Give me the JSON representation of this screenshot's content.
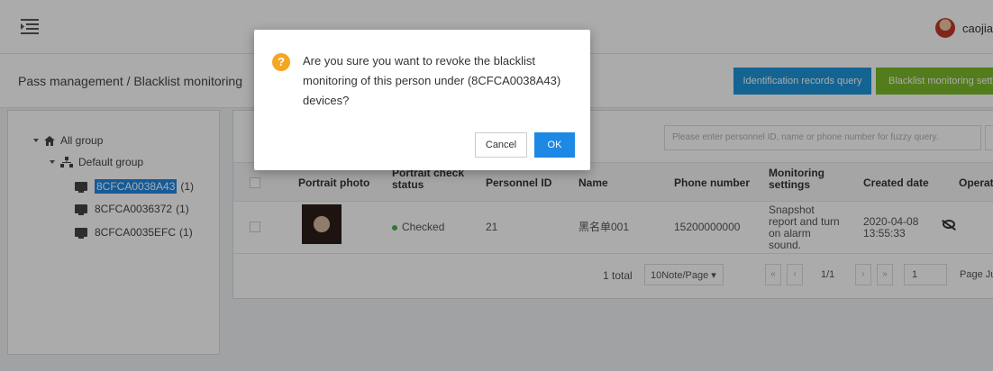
{
  "topbar": {
    "user_name": "caojia",
    "icons": [
      "menu-toggle-icon",
      "avatar"
    ]
  },
  "header": {
    "breadcrumb": "Pass management  /  Blacklist monitoring",
    "btn_identification": "Identification records query",
    "btn_blacklist": "Blacklist monitoring sett"
  },
  "tree": {
    "root_label": "All group",
    "group_label": "Default group",
    "devices": [
      {
        "label": "8CFCA0038A43",
        "count": "(1)"
      },
      {
        "label": "8CFCA0036372",
        "count": "(1)"
      },
      {
        "label": "8CFCA0035EFC",
        "count": "(1)"
      }
    ]
  },
  "search": {
    "placeholder": "Please enter personnel ID, name or phone number for fuzzy query."
  },
  "table": {
    "headers": [
      "Portrait photo",
      "Portrait check status",
      "Personnel ID",
      "Name",
      "Phone number",
      "Monitoring settings",
      "Created date",
      "Operate"
    ],
    "rows": [
      {
        "status": "Checked",
        "personnel_id": "21",
        "name": "黑名单001",
        "phone": "15200000000",
        "monitoring": "Snapshot report and turn on alarm sound.",
        "created": "2020-04-08 13:55:33"
      }
    ]
  },
  "pager": {
    "total": "1 total",
    "page_size": "10Note/Page ▾",
    "first": "«",
    "prev": "‹",
    "page_info": "1/1",
    "next": "›",
    "last": "»",
    "page_input": "1",
    "jump": "Page  Ju"
  },
  "modal": {
    "message": "Are you sure you want to revoke the blacklist monitoring of this person under (8CFCA0038A43) devices?",
    "icon_text": "?",
    "cancel": "Cancel",
    "ok": "OK"
  },
  "colors": {
    "primary": "#1e88e5",
    "identification_btn": "#1e96dc",
    "blacklist_btn": "#7cba2a",
    "warning": "#f5a623",
    "status_ok": "#4caf50"
  }
}
